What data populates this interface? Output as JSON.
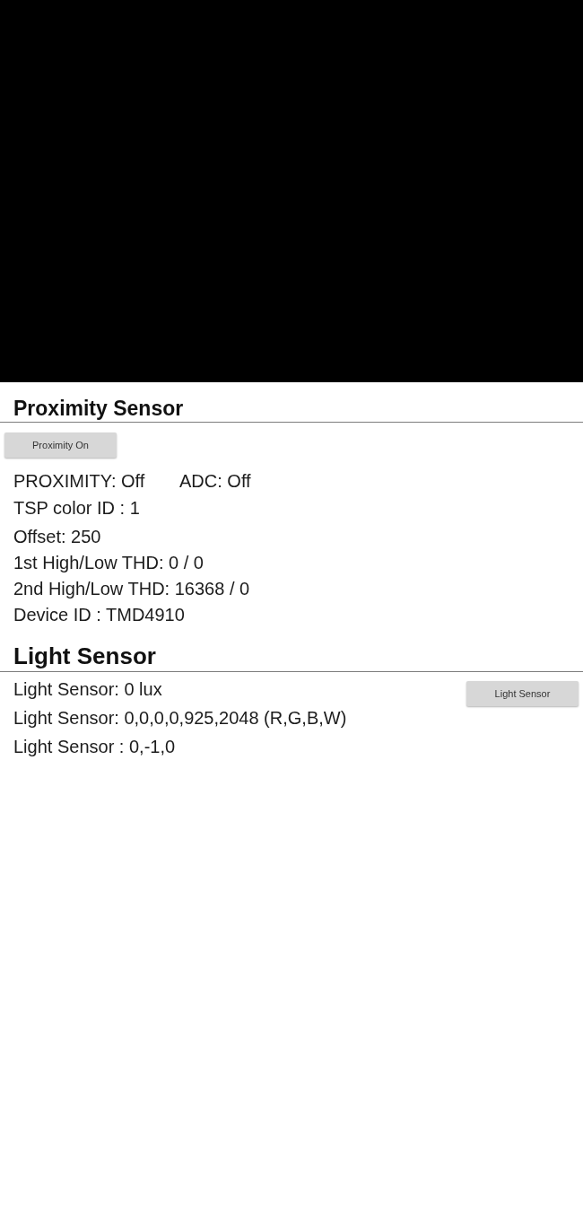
{
  "proximity_section": {
    "title": "Proximity Sensor",
    "button": "Proximity On",
    "status_row": [
      "PROXIMITY: Off",
      "ADC: Off"
    ],
    "lines": [
      "TSP color ID : 1",
      "Offset: 250",
      "1st High/Low THD: 0 / 0",
      "2nd High/Low THD: 16368 / 0",
      "Device ID : TMD4910"
    ]
  },
  "light_section": {
    "title": "Light Sensor",
    "lines": [
      "Light Sensor: 0 lux",
      "Light Sensor: 0,0,0,0,925,2048 (R,G,B,W)",
      "Light Sensor : 0,-1,0"
    ],
    "button": "Light Sensor"
  }
}
